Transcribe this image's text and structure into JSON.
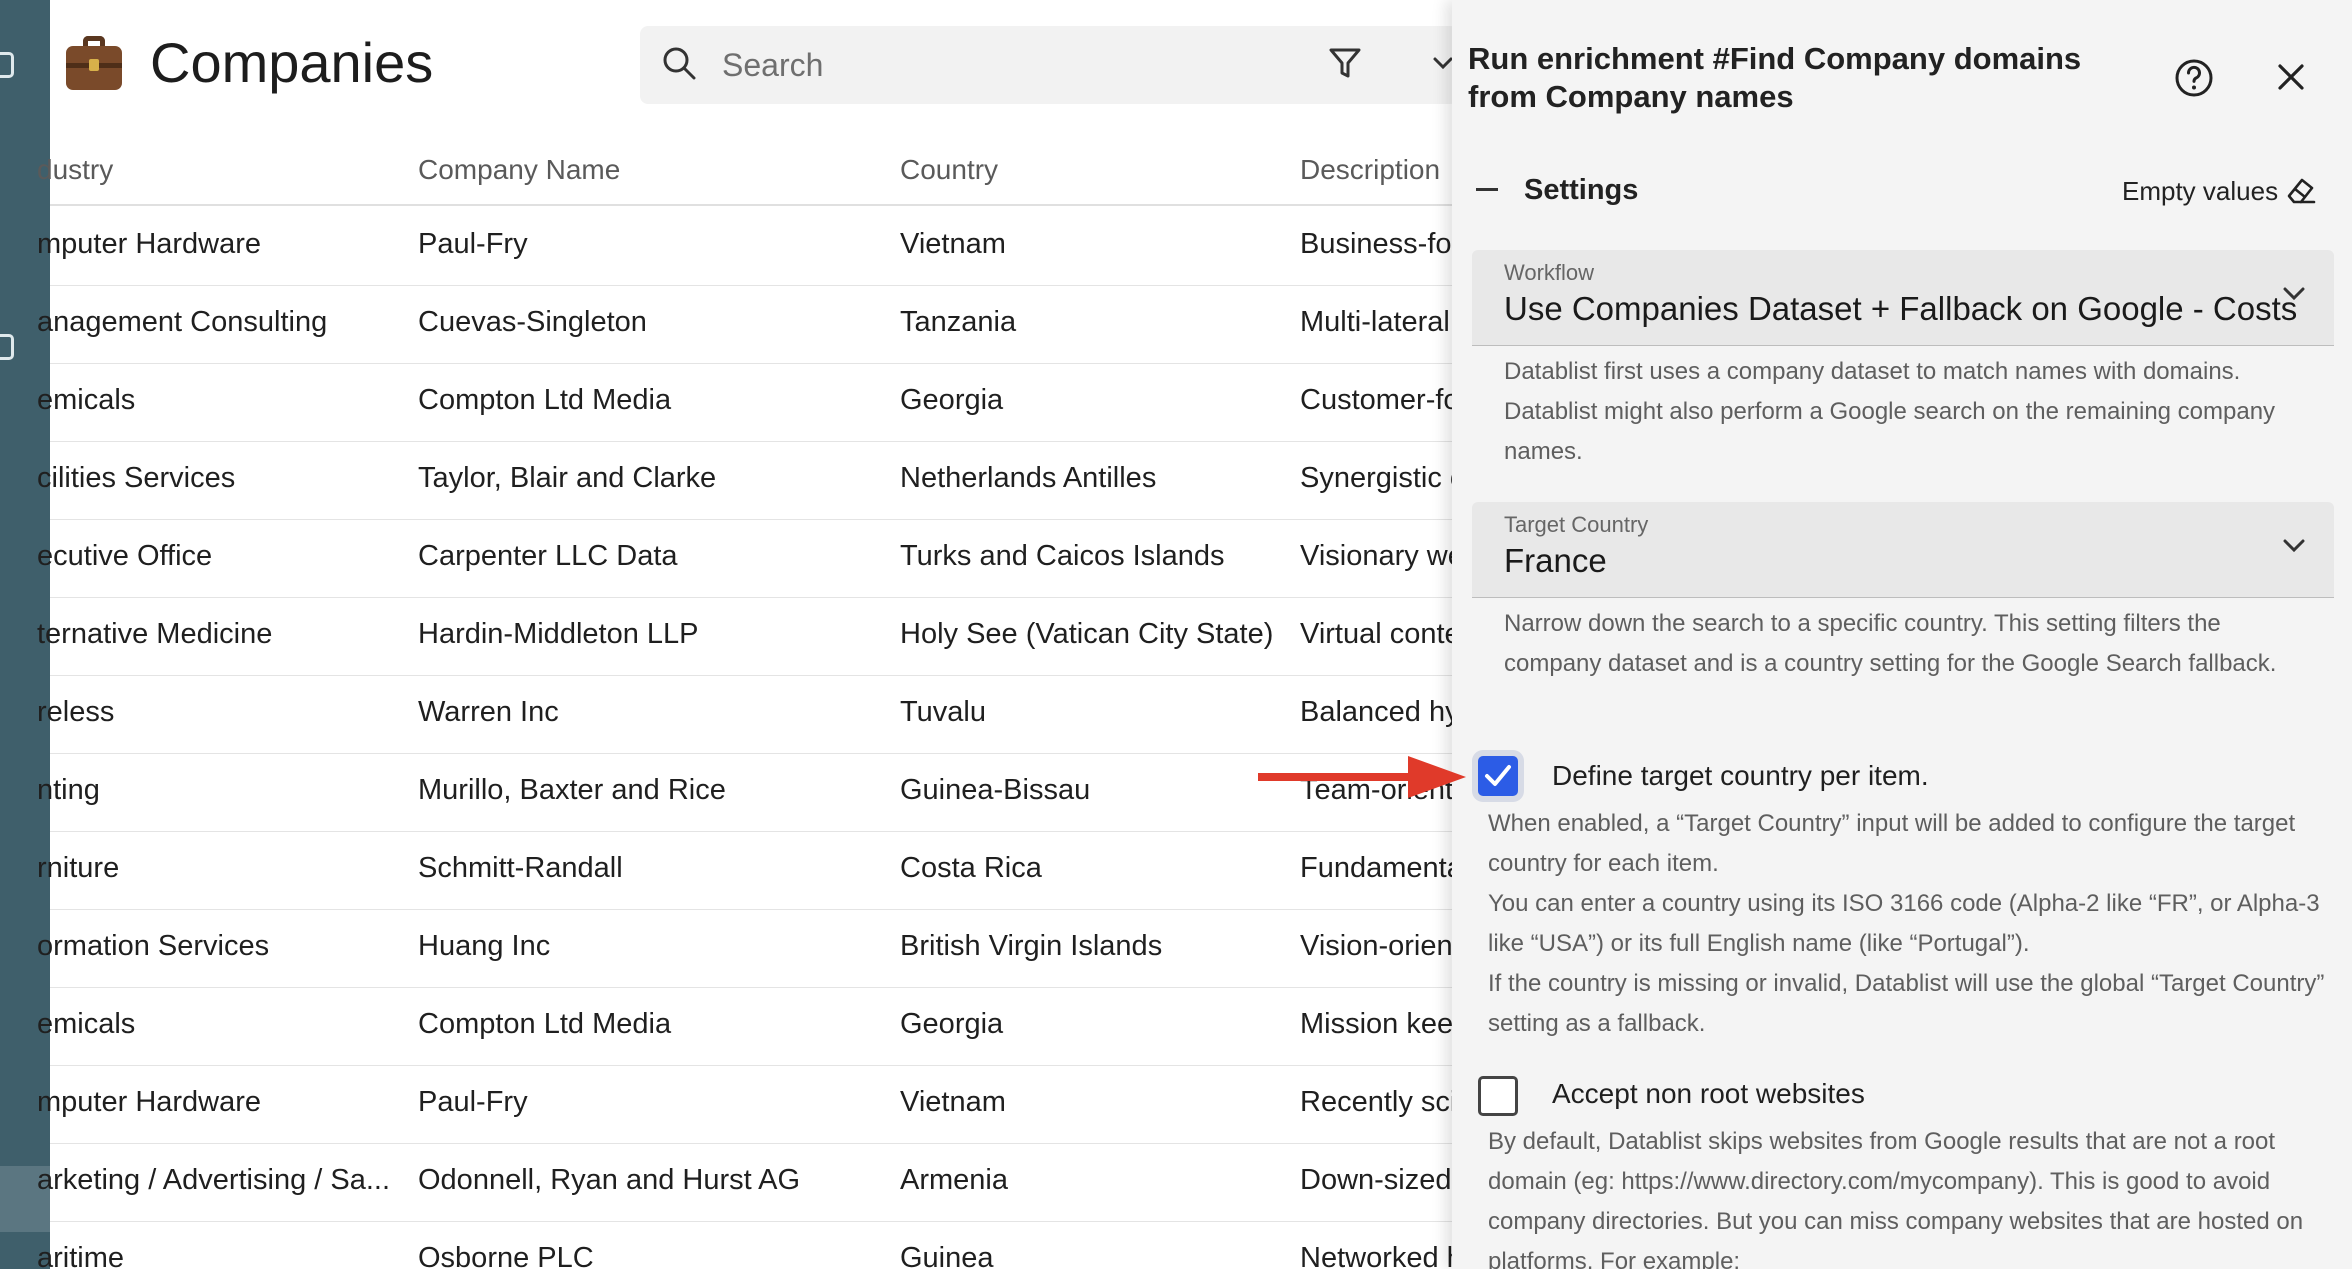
{
  "page": {
    "title": "Companies"
  },
  "search": {
    "placeholder": "Search"
  },
  "table": {
    "columns": [
      "dustry",
      "Company Name",
      "Country",
      "Description"
    ],
    "rows": [
      [
        "mputer Hardware",
        "Paul-Fry",
        "Vietnam",
        "Business-foc"
      ],
      [
        "anagement Consulting",
        "Cuevas-Singleton",
        "Tanzania",
        "Multi-lateral"
      ],
      [
        "emicals",
        "Compton Ltd Media",
        "Georgia",
        "Customer-fo"
      ],
      [
        "cilities Services",
        "Taylor, Blair and Clarke",
        "Netherlands Antilles",
        "Synergistic c"
      ],
      [
        "ecutive Office",
        "Carpenter LLC Data",
        "Turks and Caicos Islands",
        "Visionary we"
      ],
      [
        "ternative Medicine",
        "Hardin-Middleton LLP",
        "Holy See (Vatican City State)",
        "Virtual conte"
      ],
      [
        "reless",
        "Warren Inc",
        "Tuvalu",
        "Balanced hy"
      ],
      [
        "nting",
        "Murillo, Baxter and Rice",
        "Guinea-Bissau",
        "Team-oriente"
      ],
      [
        "rniture",
        "Schmitt-Randall",
        "Costa Rica",
        "Fundamenta"
      ],
      [
        "ormation Services",
        "Huang Inc",
        "British Virgin Islands",
        "Vision-orient"
      ],
      [
        "emicals",
        "Compton Ltd Media",
        "Georgia",
        "Mission keep"
      ],
      [
        "mputer Hardware",
        "Paul-Fry",
        "Vietnam",
        "Recently scie"
      ],
      [
        "arketing / Advertising / Sa...",
        "Odonnell, Ryan and Hurst AG",
        "Armenia",
        "Down-sized"
      ],
      [
        "aritime",
        "Osborne PLC",
        "Guinea",
        "Networked h"
      ]
    ]
  },
  "panel": {
    "title": "Run enrichment #Find Company domains from Company names",
    "settings_label": "Settings",
    "empty_values_label": "Empty values",
    "workflow": {
      "label": "Workflow",
      "value": "Use Companies Dataset + Fallback on Google - Costs",
      "help": "Datablist first uses a company dataset to match names with domains. Datablist might also perform a Google search on the remaining company names."
    },
    "target_country": {
      "label": "Target Country",
      "value": "France",
      "help": "Narrow down the search to a specific country. This setting filters the company dataset and is a country setting for the Google Search fallback."
    },
    "define_per_item": {
      "label": "Define target country per item.",
      "checked": true,
      "help_1": "When enabled, a “Target Country” input will be added to configure the target country for each item.",
      "help_2": "You can enter a country using its ISO 3166 code (Alpha-2 like “FR”, or Alpha-3 like “USA”) or its full English name (like “Portugal”).",
      "help_3": "If the country is missing or invalid, Datablist will use the global “Target Country” setting as a fallback."
    },
    "accept_non_root": {
      "label": "Accept non root websites",
      "checked": false,
      "help": "By default, Datablist skips websites from Google results that are not a root domain (eg: https://www.directory.com/mycompany). This is good to avoid company directories. But you can miss company websites that are hosted on platforms. For example:"
    }
  },
  "colors": {
    "sidebar": "#3f5f6b",
    "checkbox_accent": "#2c5ce6",
    "arrow": "#e03a2a"
  },
  "icons": [
    "briefcase-icon",
    "search-icon",
    "filter-icon",
    "chevron-down-icon",
    "help-icon",
    "close-icon",
    "collapse-icon",
    "eraser-icon",
    "check-icon",
    "arrow-annotation"
  ]
}
